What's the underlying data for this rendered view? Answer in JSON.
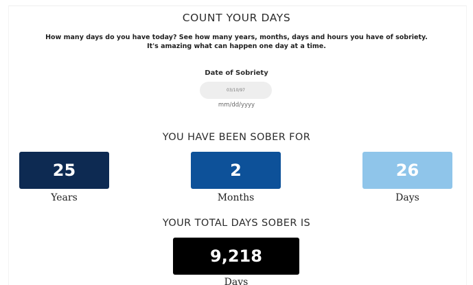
{
  "header": {
    "title": "COUNT YOUR DAYS",
    "intro_line1": "How many days do you have today? See how many years, months, days and hours you have of sobriety.",
    "intro_line2": "It's amazing what can happen one day at a time."
  },
  "form": {
    "date_label": "Date of Sobriety",
    "date_value": "03/10/97",
    "date_format_hint": "mm/dd/yyyy"
  },
  "result": {
    "heading": "YOU HAVE BEEN SOBER FOR",
    "years": {
      "value": "25",
      "label": "Years",
      "color": "#0d2a52"
    },
    "months": {
      "value": "2",
      "label": "Months",
      "color": "#0d5199"
    },
    "days": {
      "value": "26",
      "label": "Days",
      "color": "#8fc5ea"
    }
  },
  "total": {
    "heading": "YOUR TOTAL DAYS SOBER IS",
    "value": "9,218",
    "label": "Days",
    "color": "#000000"
  }
}
